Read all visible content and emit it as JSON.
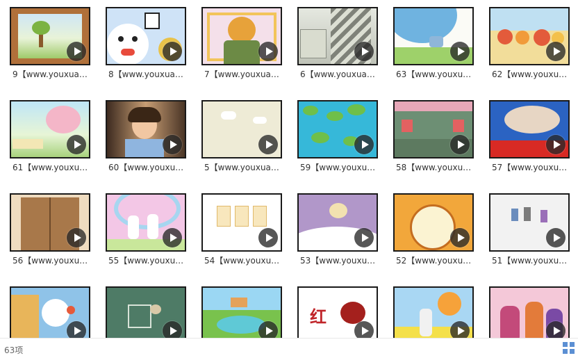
{
  "items": [
    {
      "label": "9【www.youxuan…",
      "scene": "framed-landscape"
    },
    {
      "label": "8【www.youxuan…",
      "scene": "snowman-character"
    },
    {
      "label": "7【www.youxuan…",
      "scene": "tiger-puppet"
    },
    {
      "label": "6【www.youxuan…",
      "scene": "stone-village"
    },
    {
      "label": "63【www.youxu…",
      "scene": "bird-on-branch"
    },
    {
      "label": "62【www.youxu…",
      "scene": "autumn-animals"
    },
    {
      "label": "61【www.youxu…",
      "scene": "peach-blossom"
    },
    {
      "label": "60【www.youxu…",
      "scene": "girl-at-desk"
    },
    {
      "label": "5【www.youxuan…",
      "scene": "clouds-blank"
    },
    {
      "label": "59【www.youxu…",
      "scene": "lotus-pond"
    },
    {
      "label": "58【www.youxu…",
      "scene": "chalkboard-left-right"
    },
    {
      "label": "57【www.youxu…",
      "scene": "puppet-stage"
    },
    {
      "label": "56【www.youxu…",
      "scene": "wooden-door"
    },
    {
      "label": "55【www.youxu…",
      "scene": "rainbow-rabbits"
    },
    {
      "label": "54【www.youxu…",
      "scene": "character-cards"
    },
    {
      "label": "53【www.youxu…",
      "scene": "purple-room"
    },
    {
      "label": "52【www.youxu…",
      "scene": "cuckoo-clock"
    },
    {
      "label": "51【www.youxu…",
      "scene": "small-figures"
    },
    {
      "label": "",
      "scene": "cartoon-dog"
    },
    {
      "label": "",
      "scene": "chalkboard-drawing"
    },
    {
      "label": "",
      "scene": "meadow-pond"
    },
    {
      "label": "",
      "scene": "red-character"
    },
    {
      "label": "",
      "scene": "sun-and-flowers"
    },
    {
      "label": "",
      "scene": "costume-puppets"
    }
  ],
  "status": {
    "count": "63项"
  },
  "colors": {
    "accent": "#5b8fd3",
    "border": "#1a1a1a"
  }
}
